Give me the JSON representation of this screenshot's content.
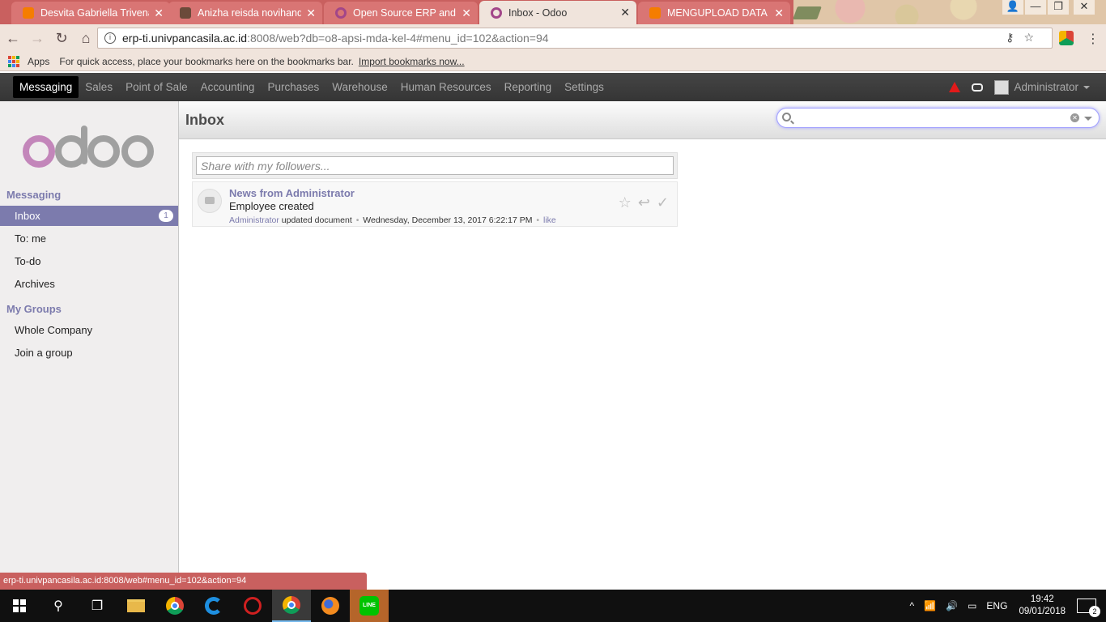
{
  "browser": {
    "tabs": [
      {
        "title": "Desvita Gabriella Trivena",
        "favicon": "blogger-icon"
      },
      {
        "title": "Anizha reisda novihandik",
        "favicon": "photo-icon"
      },
      {
        "title": "Open Source ERP and CR",
        "favicon": "odoo-icon"
      },
      {
        "title": "Inbox - Odoo",
        "favicon": "odoo-icon"
      },
      {
        "title": "MENGUPLOAD DATA DI",
        "favicon": "blogger-icon"
      }
    ],
    "url_host": "erp-ti.univpancasila.ac.id",
    "url_path": ":8008/web?db=o8-apsi-mda-kel-4#menu_id=102&action=94",
    "bookmarks_apps": "Apps",
    "bookmarks_hint": "For quick access, place your bookmarks here on the bookmarks bar.",
    "bookmarks_import": "Import bookmarks now...",
    "status_url": "erp-ti.univpancasila.ac.id:8008/web#menu_id=102&action=94"
  },
  "topbar": {
    "menu": [
      "Messaging",
      "Sales",
      "Point of Sale",
      "Accounting",
      "Purchases",
      "Warehouse",
      "Human Resources",
      "Reporting",
      "Settings"
    ],
    "user": "Administrator"
  },
  "sidebar": {
    "section_messaging": "Messaging",
    "inbox": "Inbox",
    "inbox_count": "1",
    "to_me": "To: me",
    "todo": "To-do",
    "archives": "Archives",
    "section_groups": "My Groups",
    "whole_company": "Whole Company",
    "join_group": "Join a group"
  },
  "main": {
    "title": "Inbox",
    "compose_placeholder": "Share with my followers...",
    "message": {
      "subject": "News from Administrator",
      "body": "Employee created",
      "author": "Administrator",
      "action": "updated document",
      "date": "Wednesday, December 13, 2017 6:22:17 PM",
      "like": "like"
    }
  },
  "taskbar": {
    "lang": "ENG",
    "time": "19:42",
    "date": "09/01/2018",
    "notifications": "2",
    "line_label": "LINE"
  },
  "colors": {
    "odoo_accent": "#7c7bad",
    "chrome_theme": "#c9605f"
  }
}
